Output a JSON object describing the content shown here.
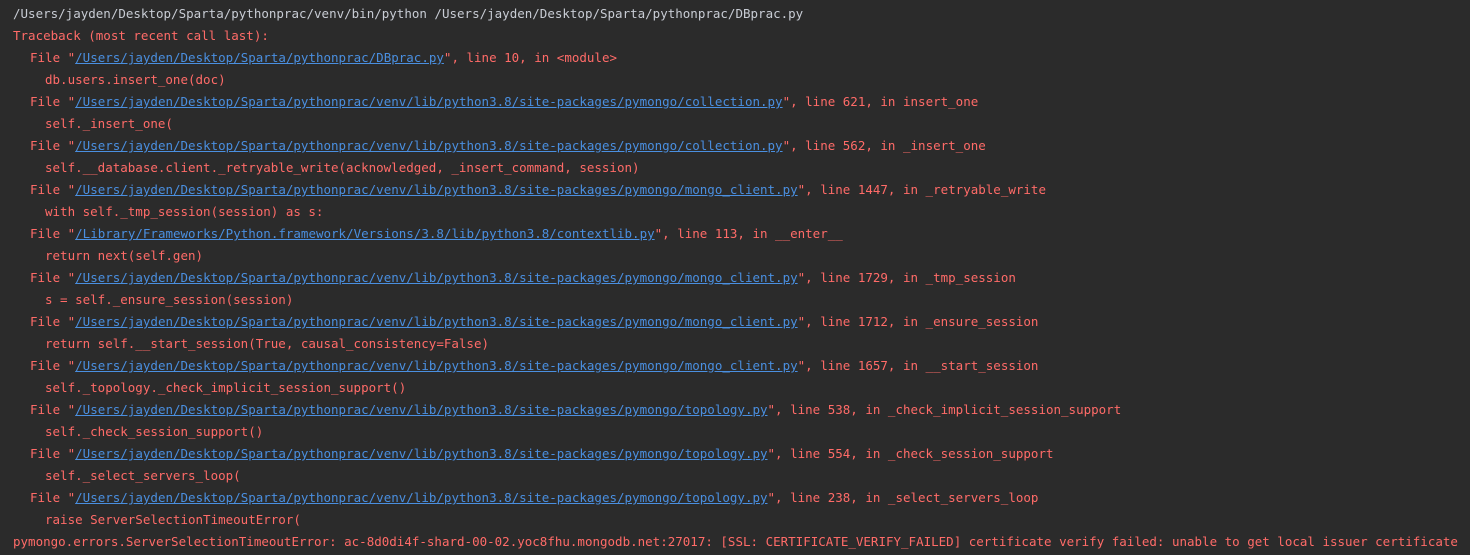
{
  "console": {
    "command": "/Users/jayden/Desktop/Sparta/pythonprac/venv/bin/python /Users/jayden/Desktop/Sparta/pythonprac/DBprac.py",
    "traceback_header": "Traceback (most recent call last):",
    "file_prefix": "File \"",
    "frames": [
      {
        "path": "/Users/jayden/Desktop/Sparta/pythonprac/DBprac.py",
        "suffix": "\", line 10, in <module>",
        "code": "db.users.insert_one(doc)"
      },
      {
        "path": "/Users/jayden/Desktop/Sparta/pythonprac/venv/lib/python3.8/site-packages/pymongo/collection.py",
        "suffix": "\", line 621, in insert_one",
        "code": "self._insert_one("
      },
      {
        "path": "/Users/jayden/Desktop/Sparta/pythonprac/venv/lib/python3.8/site-packages/pymongo/collection.py",
        "suffix": "\", line 562, in _insert_one",
        "code": "self.__database.client._retryable_write(acknowledged, _insert_command, session)"
      },
      {
        "path": "/Users/jayden/Desktop/Sparta/pythonprac/venv/lib/python3.8/site-packages/pymongo/mongo_client.py",
        "suffix": "\", line 1447, in _retryable_write",
        "code": "with self._tmp_session(session) as s:"
      },
      {
        "path": "/Library/Frameworks/Python.framework/Versions/3.8/lib/python3.8/contextlib.py",
        "suffix": "\", line 113, in __enter__",
        "code": "return next(self.gen)"
      },
      {
        "path": "/Users/jayden/Desktop/Sparta/pythonprac/venv/lib/python3.8/site-packages/pymongo/mongo_client.py",
        "suffix": "\", line 1729, in _tmp_session",
        "code": "s = self._ensure_session(session)"
      },
      {
        "path": "/Users/jayden/Desktop/Sparta/pythonprac/venv/lib/python3.8/site-packages/pymongo/mongo_client.py",
        "suffix": "\", line 1712, in _ensure_session",
        "code": "return self.__start_session(True, causal_consistency=False)"
      },
      {
        "path": "/Users/jayden/Desktop/Sparta/pythonprac/venv/lib/python3.8/site-packages/pymongo/mongo_client.py",
        "suffix": "\", line 1657, in __start_session",
        "code": "self._topology._check_implicit_session_support()"
      },
      {
        "path": "/Users/jayden/Desktop/Sparta/pythonprac/venv/lib/python3.8/site-packages/pymongo/topology.py",
        "suffix": "\", line 538, in _check_implicit_session_support",
        "code": "self._check_session_support()"
      },
      {
        "path": "/Users/jayden/Desktop/Sparta/pythonprac/venv/lib/python3.8/site-packages/pymongo/topology.py",
        "suffix": "\", line 554, in _check_session_support",
        "code": "self._select_servers_loop("
      },
      {
        "path": "/Users/jayden/Desktop/Sparta/pythonprac/venv/lib/python3.8/site-packages/pymongo/topology.py",
        "suffix": "\", line 238, in _select_servers_loop",
        "code": "raise ServerSelectionTimeoutError("
      }
    ],
    "exception": "pymongo.errors.ServerSelectionTimeoutError: ac-8d0di4f-shard-00-02.yoc8fhu.mongodb.net:27017: [SSL: CERTIFICATE_VERIFY_FAILED] certificate verify failed: unable to get local issuer certificate"
  },
  "colors": {
    "background": "#2b2b2b",
    "command_text": "#c8ccd4",
    "error_text": "#ff6b68",
    "link": "#4a8fe0"
  }
}
